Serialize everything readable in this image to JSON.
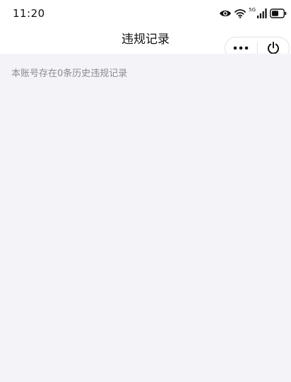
{
  "status_bar": {
    "time": "11:20",
    "network_label": "5G",
    "icons": [
      "eye-icon",
      "wifi-icon",
      "signal-icon",
      "battery-icon"
    ]
  },
  "nav_bar": {
    "title": "违规记录",
    "menu_icon": "more-dots-icon",
    "close_icon": "power-icon"
  },
  "content": {
    "summary_text": "本账号存在0条历史违规记录"
  },
  "colors": {
    "background": "#f4f4f8",
    "header_background": "#ffffff",
    "summary_text": "#8a8a8f",
    "title_text": "#111111"
  }
}
